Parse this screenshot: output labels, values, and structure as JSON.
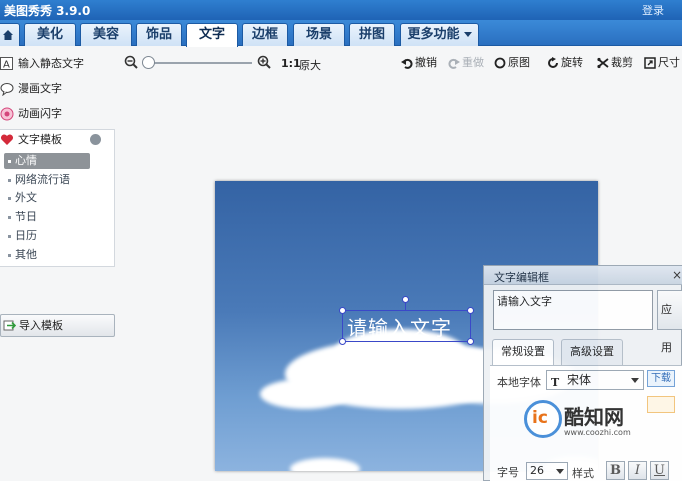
{
  "window": {
    "title": "美图秀秀 3.9.0",
    "login_label": "登录"
  },
  "tabs": [
    {
      "label": "美化"
    },
    {
      "label": "美容"
    },
    {
      "label": "饰品"
    },
    {
      "label": "文字"
    },
    {
      "label": "边框"
    },
    {
      "label": "场景"
    },
    {
      "label": "拼图"
    },
    {
      "label": "更多功能"
    }
  ],
  "active_tab": "文字",
  "toolbar": {
    "zoom_ratio": "1:1",
    "original_size": "原大",
    "undo": "撤销",
    "redo": "重做",
    "original": "原图",
    "rotate": "旋转",
    "crop": "裁剪",
    "size": "尺寸"
  },
  "sidebar": {
    "static_text": "输入静态文字",
    "comic_text": "漫画文字",
    "animated_text": "动画闪字",
    "templates": {
      "title": "文字模板",
      "items": [
        {
          "label": "心情",
          "selected": true
        },
        {
          "label": "网络流行语"
        },
        {
          "label": "外文"
        },
        {
          "label": "节日"
        },
        {
          "label": "日历"
        },
        {
          "label": "其他"
        }
      ]
    },
    "import_template": "导入模板"
  },
  "canvas": {
    "text_overlay": "请输入文字"
  },
  "text_editor": {
    "title": "文字编辑框",
    "close": "×",
    "input_value": "请输入文字",
    "apply_label": "应用",
    "tabs": [
      {
        "label": "常规设置"
      },
      {
        "label": "高级设置"
      }
    ],
    "local_font_label": "本地字体",
    "font_value": "宋体",
    "download_label": "下载",
    "font_size_label": "字号",
    "font_size_value": "26",
    "style_label": "样式",
    "bold": "B",
    "italic": "I",
    "underline": "U"
  },
  "watermark": {
    "logo_text": "酷知网",
    "url": "www.coozhi.com"
  },
  "colors": {
    "accent": "#2a6fc0",
    "selection": "#3a48c8",
    "download": "#2b68b6"
  }
}
